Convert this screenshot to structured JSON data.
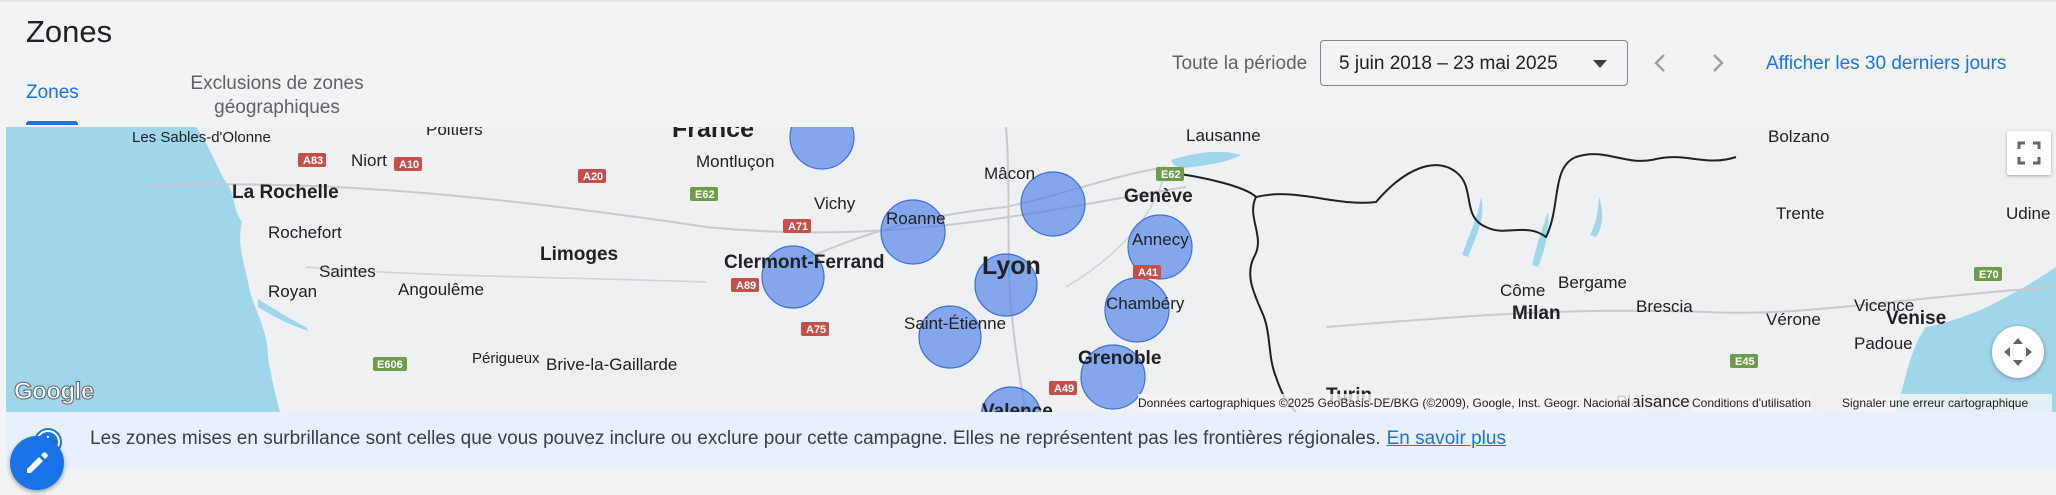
{
  "header": {
    "title": "Zones",
    "tabs": [
      {
        "label": "Zones",
        "active": true
      },
      {
        "label_line1": "Exclusions de zones",
        "label_line2": "géographiques",
        "active": false
      }
    ],
    "period_label": "Toute la période",
    "date_range": "5 juin 2018 – 23 mai 2025",
    "last_30_days_link": "Afficher les 30 derniers jours"
  },
  "map": {
    "cities": {
      "sables": "Les Sables-d'Olonne",
      "niort": "Niort",
      "poitiers": "Poitiers",
      "france": "France",
      "montlucon": "Montluçon",
      "rochelle": "La Rochelle",
      "rochefort": "Rochefort",
      "saintes": "Saintes",
      "royan": "Royan",
      "angouleme": "Angoulême",
      "limoges": "Limoges",
      "vichy": "Vichy",
      "clermont": "Clermont-Ferrand",
      "roanne": "Roanne",
      "macon": "Mâcon",
      "lyon": "Lyon",
      "stetienne": "Saint-Étienne",
      "perigueux": "Périgueux",
      "brive": "Brive-la-Gaillarde",
      "valence": "Valence",
      "lausanne": "Lausanne",
      "geneve": "Genève",
      "annecy": "Annecy",
      "chambery": "Chambéry",
      "grenoble": "Grenoble",
      "turin": "Turin",
      "milan": "Milan",
      "come": "Côme",
      "bergame": "Bergame",
      "brescia": "Brescia",
      "bolzano": "Bolzano",
      "trente": "Trente",
      "udine": "Udine",
      "vicence": "Vicence",
      "verone": "Vérone",
      "venise": "Venise",
      "padoue": "Padoue",
      "plaisance": "Plaisance"
    },
    "roads": {
      "a83": "A83",
      "a10": "A10",
      "a20": "A20",
      "e62w": "E62",
      "a71": "A71",
      "a89": "A89",
      "a75": "A75",
      "e606": "E606",
      "e62e": "E62",
      "a41": "A41",
      "a49": "A49",
      "e70": "E70",
      "e45": "E45"
    },
    "logo": "Google",
    "attribution": "Données cartographiques ©2025 GeoBasis-DE/BKG (©2009), Google, Inst. Geogr. Nacional",
    "terms": "Conditions d'utilisation",
    "report": "Signaler une erreur cartographique",
    "highlight_color": "#4c7fe8"
  },
  "banner": {
    "text": "Les zones mises en surbrillance sont celles que vous pouvez inclure ou exclure pour cette campagne. Elles ne représentent pas les frontières régionales.",
    "link": "En savoir plus"
  },
  "icons": {
    "fullscreen": "fullscreen-icon",
    "pan": "pan-control-icon",
    "info": "info-icon",
    "edit": "pencil-icon",
    "prev": "chevron-left-icon",
    "next": "chevron-right-icon",
    "dropdown": "caret-down-icon"
  }
}
